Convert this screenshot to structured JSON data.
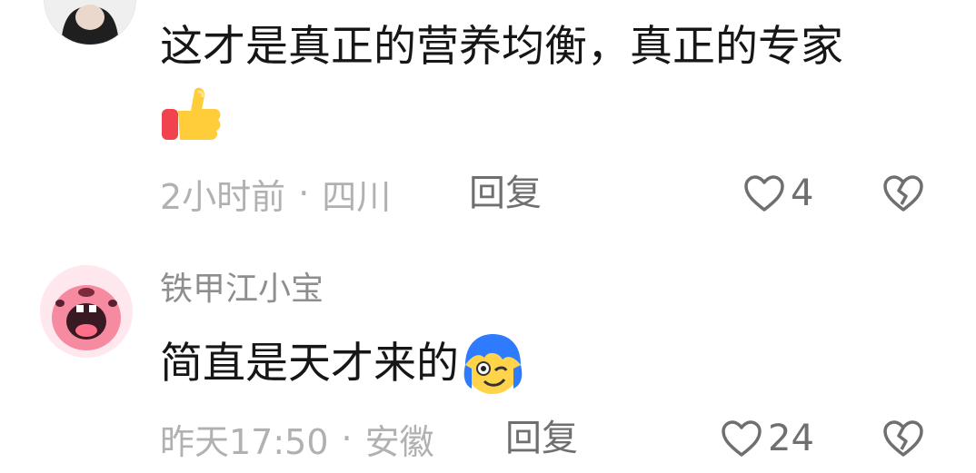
{
  "comments": [
    {
      "text": "这才是真正的营养均衡，真正的专家",
      "emoji_icon": "thumbs-up-icon",
      "time": "2小时前",
      "location": "四川",
      "reply_label": "回复",
      "like_count": "4"
    },
    {
      "username": "铁甲江小宝",
      "text": "简直是天才来的",
      "emoji_icon": "goofy-blue-hair-face-icon",
      "time": "昨天17:50",
      "location": "安徽",
      "reply_label": "回复",
      "like_count": "24"
    }
  ],
  "separator": "·",
  "colors": {
    "text_primary": "#161616",
    "text_secondary": "#8e8e8e",
    "meta": "#b1b1b1",
    "action": "#6f6f6f"
  }
}
